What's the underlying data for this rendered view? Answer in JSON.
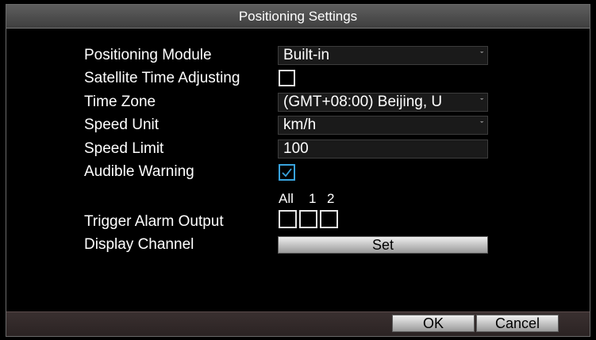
{
  "window": {
    "title": "Positioning Settings"
  },
  "form": {
    "positioning_module": {
      "label": "Positioning Module",
      "value": "Built-in"
    },
    "satellite_time": {
      "label": "Satellite Time Adjusting",
      "checked": false
    },
    "time_zone": {
      "label": "Time Zone",
      "value": "(GMT+08:00) Beijing, U"
    },
    "speed_unit": {
      "label": "Speed Unit",
      "value": "km/h"
    },
    "speed_limit": {
      "label": "Speed Limit",
      "value": "100"
    },
    "audible_warning": {
      "label": "Audible Warning",
      "checked": true
    },
    "trigger_alarm": {
      "label": "Trigger Alarm Output",
      "headers": [
        "All",
        "1",
        "2"
      ],
      "checked": [
        false,
        false,
        false
      ]
    },
    "display_channel": {
      "label": "Display Channel",
      "button": "Set"
    }
  },
  "footer": {
    "ok": "OK",
    "cancel": "Cancel"
  },
  "colors": {
    "accent": "#38a2dc",
    "title_bg": "#4a4a4a",
    "footer_bg": "#332929"
  },
  "icons": {
    "dropdown": "chevron-down-icon",
    "check": "checkmark-icon"
  }
}
